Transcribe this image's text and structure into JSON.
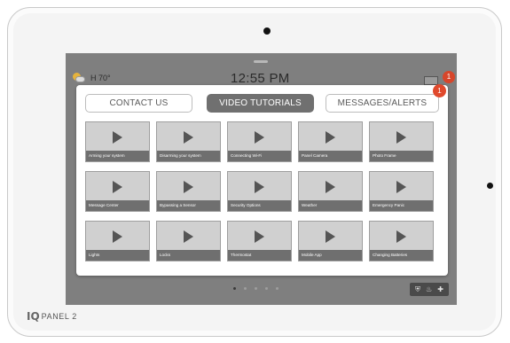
{
  "status_bar": {
    "weather_label": "H 70°",
    "time": "12:55 PM",
    "messages_badge": "1"
  },
  "tabs": [
    {
      "label": "CONTACT US",
      "active": false
    },
    {
      "label": "VIDEO TUTORIALS",
      "active": true
    },
    {
      "label": "MESSAGES/ALERTS",
      "active": false,
      "badge": "1"
    }
  ],
  "videos": [
    "Arming your system",
    "Disarming your system",
    "Connecting Wi-Fi",
    "Panel Camera",
    "Photo Frame",
    "Message Center",
    "Bypassing a Sensor",
    "Security Options",
    "Weather",
    "Emergency Panic",
    "Lights",
    "Locks",
    "Thermostat",
    "Mobile App",
    "Changing Batteries"
  ],
  "pager": {
    "pages": 5,
    "current": 1
  },
  "quick_actions": [
    "shield-icon",
    "fire-icon",
    "medical-cross-icon"
  ],
  "brand": {
    "logo_mark": "IQ",
    "name": "PANEL 2"
  },
  "colors": {
    "badge": "#e0492c",
    "active_tab": "#707070",
    "screen_bg": "#7f7f7f"
  }
}
